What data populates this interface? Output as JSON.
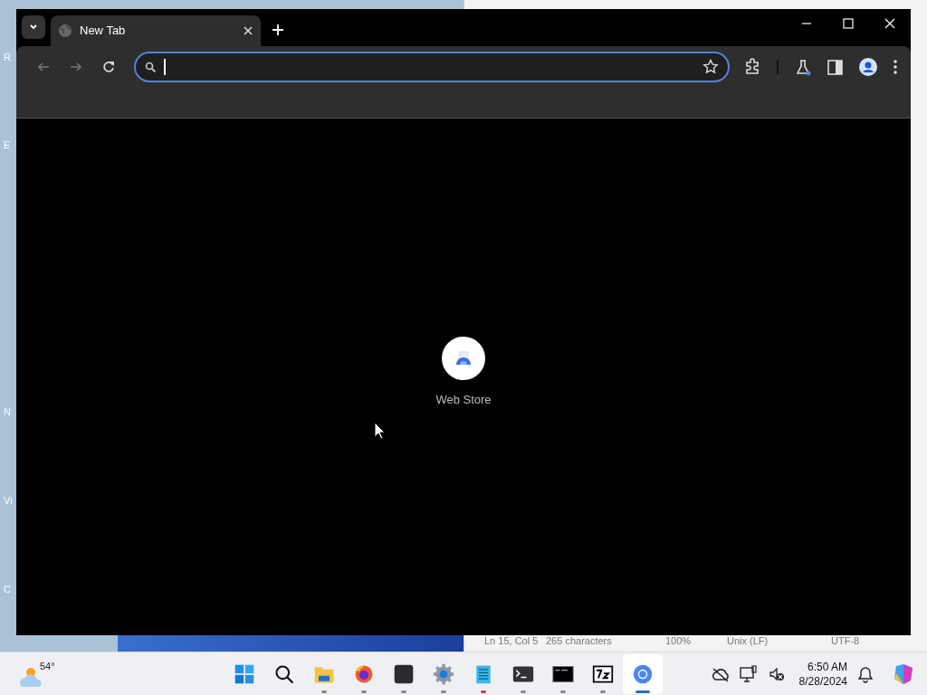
{
  "desktop": {
    "icon_labels": [
      "R",
      "E",
      "N",
      "Vi",
      "C"
    ]
  },
  "notepad": {
    "status_bar": [
      "Ln 15, Col 5",
      "265 characters",
      "100%",
      "Unix (LF)",
      "UTF-8"
    ]
  },
  "browser": {
    "tabs": [
      {
        "title": "New Tab",
        "selected": true
      }
    ],
    "bookmark_starred": false,
    "shortcuts": [
      {
        "label": "Web Store"
      }
    ]
  },
  "taskbar": {
    "weather": "54°",
    "apps": [
      {
        "kind": "start",
        "running": false,
        "active": false
      },
      {
        "kind": "search",
        "running": false,
        "active": false
      },
      {
        "kind": "files",
        "running": true,
        "active": false
      },
      {
        "kind": "firefox",
        "running": true,
        "active": false
      },
      {
        "kind": "dark",
        "running": true,
        "active": false
      },
      {
        "kind": "settings",
        "running": true,
        "active": false
      },
      {
        "kind": "notepad",
        "running": true,
        "active": false
      },
      {
        "kind": "terminal",
        "running": true,
        "active": false
      },
      {
        "kind": "console",
        "running": true,
        "active": false
      },
      {
        "kind": "sevenzip",
        "running": true,
        "active": false
      },
      {
        "kind": "chromium",
        "running": true,
        "active": true
      }
    ],
    "time": "6:50 AM",
    "date": "8/28/2024"
  }
}
